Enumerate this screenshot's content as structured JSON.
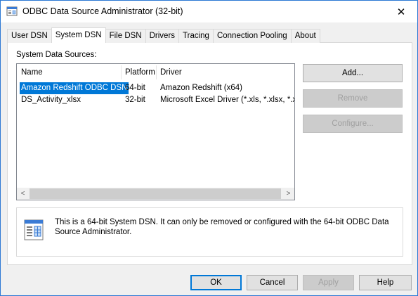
{
  "window": {
    "title": "ODBC Data Source Administrator (32-bit)",
    "close_glyph": "✕"
  },
  "tabs": [
    {
      "label": "User DSN",
      "active": false
    },
    {
      "label": "System DSN",
      "active": true
    },
    {
      "label": "File DSN",
      "active": false
    },
    {
      "label": "Drivers",
      "active": false
    },
    {
      "label": "Tracing",
      "active": false
    },
    {
      "label": "Connection Pooling",
      "active": false
    },
    {
      "label": "About",
      "active": false
    }
  ],
  "system_dsn": {
    "section_label": "System Data Sources:",
    "columns": {
      "name": "Name",
      "platform": "Platform",
      "driver": "Driver"
    },
    "rows": [
      {
        "name": "Amazon Redshift ODBC DSN",
        "platform": "64-bit",
        "driver": "Amazon Redshift (x64)",
        "selected": true
      },
      {
        "name": "DS_Activity_xlsx",
        "platform": "32-bit",
        "driver": "Microsoft Excel Driver (*.xls, *.xlsx, *.xlsm",
        "selected": false
      }
    ],
    "scroll_left_glyph": "<",
    "scroll_right_glyph": ">",
    "buttons": {
      "add": "Add...",
      "remove": "Remove",
      "configure": "Configure..."
    },
    "info_text": "This is a 64-bit System DSN. It can only be removed or configured with the 64-bit ODBC Data Source Administrator."
  },
  "footer": {
    "ok": "OK",
    "cancel": "Cancel",
    "apply": "Apply",
    "help": "Help"
  },
  "colors": {
    "selection": "#0078d7",
    "window_border": "#2b78d4"
  }
}
